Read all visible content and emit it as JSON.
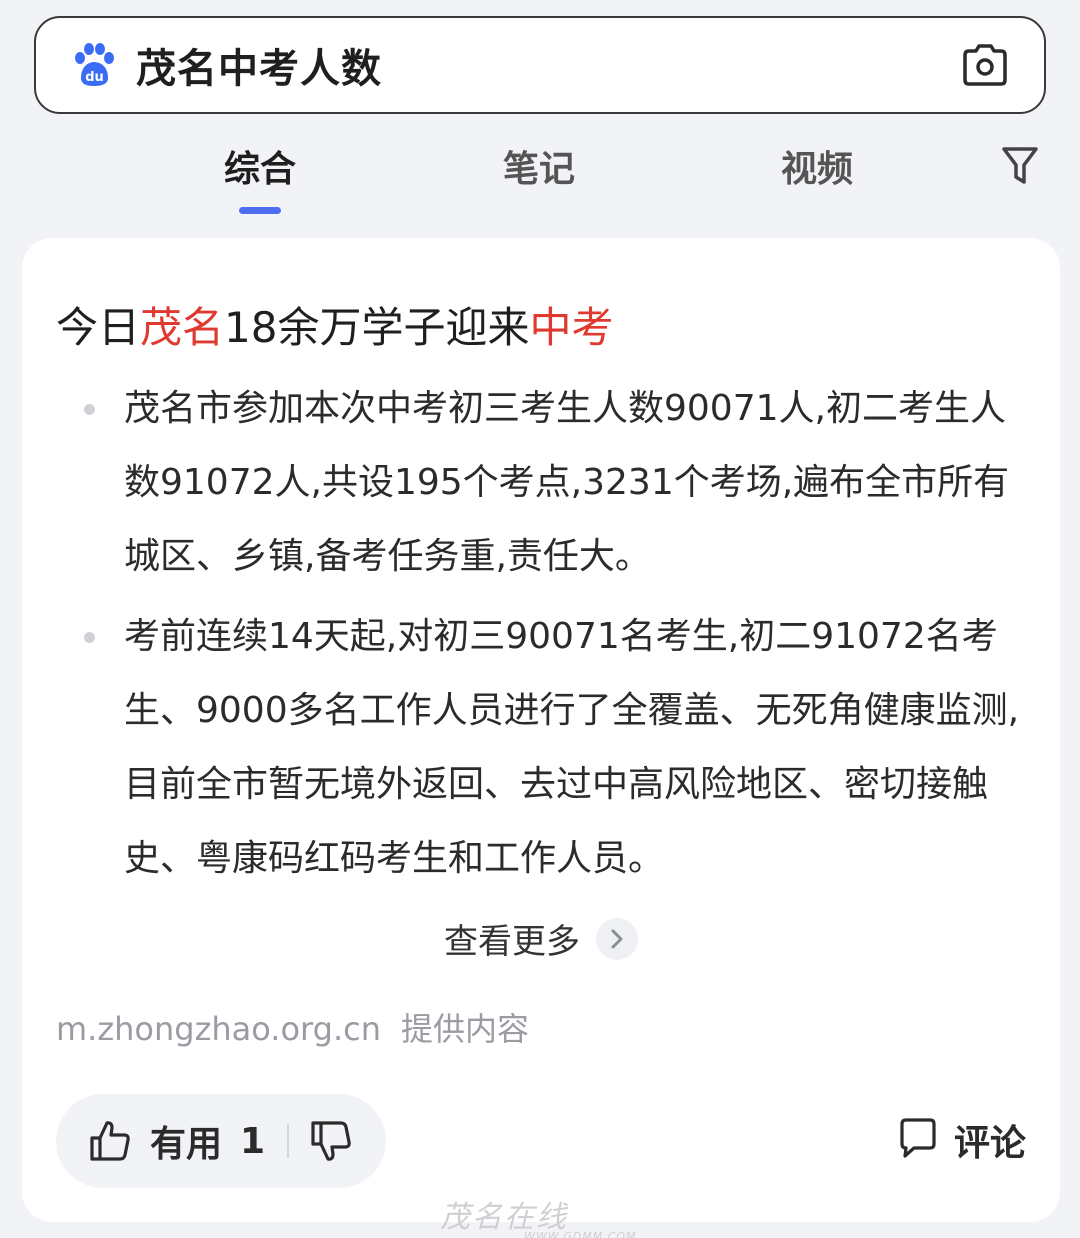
{
  "search": {
    "query": "茂名中考人数",
    "logo_icon": "baidu-paw-icon",
    "camera_icon": "camera-icon"
  },
  "tabs": [
    {
      "label": "综合",
      "active": true
    },
    {
      "label": "笔记",
      "active": false
    },
    {
      "label": "视频",
      "active": false
    }
  ],
  "filter_icon": "filter-icon",
  "card": {
    "title_parts": [
      {
        "text": "今日",
        "highlight": false
      },
      {
        "text": "茂名",
        "highlight": true
      },
      {
        "text": "18余万学子迎来",
        "highlight": false
      },
      {
        "text": "中考",
        "highlight": true
      }
    ],
    "bullets": [
      "茂名市参加本次中考初三考生人数90071人,初二考生人数91072人,共设195个考点,3231个考场,遍布全市所有城区、乡镇,备考任务重,责任大。",
      "考前连续14天起,对初三90071名考生,初二91072名考生、9000多名工作人员进行了全覆盖、无死角健康监测,目前全市暂无境外返回、去过中高风险地区、密切接触史、粤康码红码考生和工作人员。"
    ],
    "more_label": "查看更多",
    "source_domain": "m.zhongzhao.org.cn",
    "source_suffix": "提供内容",
    "useful_label": "有用",
    "useful_count": "1",
    "comment_label": "评论"
  },
  "watermark": {
    "text": "茂名在线",
    "sub": "WWW.GDMM.COM"
  },
  "colors": {
    "accent": "#4e6ef2",
    "highlight": "#e03a30",
    "background": "#f2f3f7"
  }
}
